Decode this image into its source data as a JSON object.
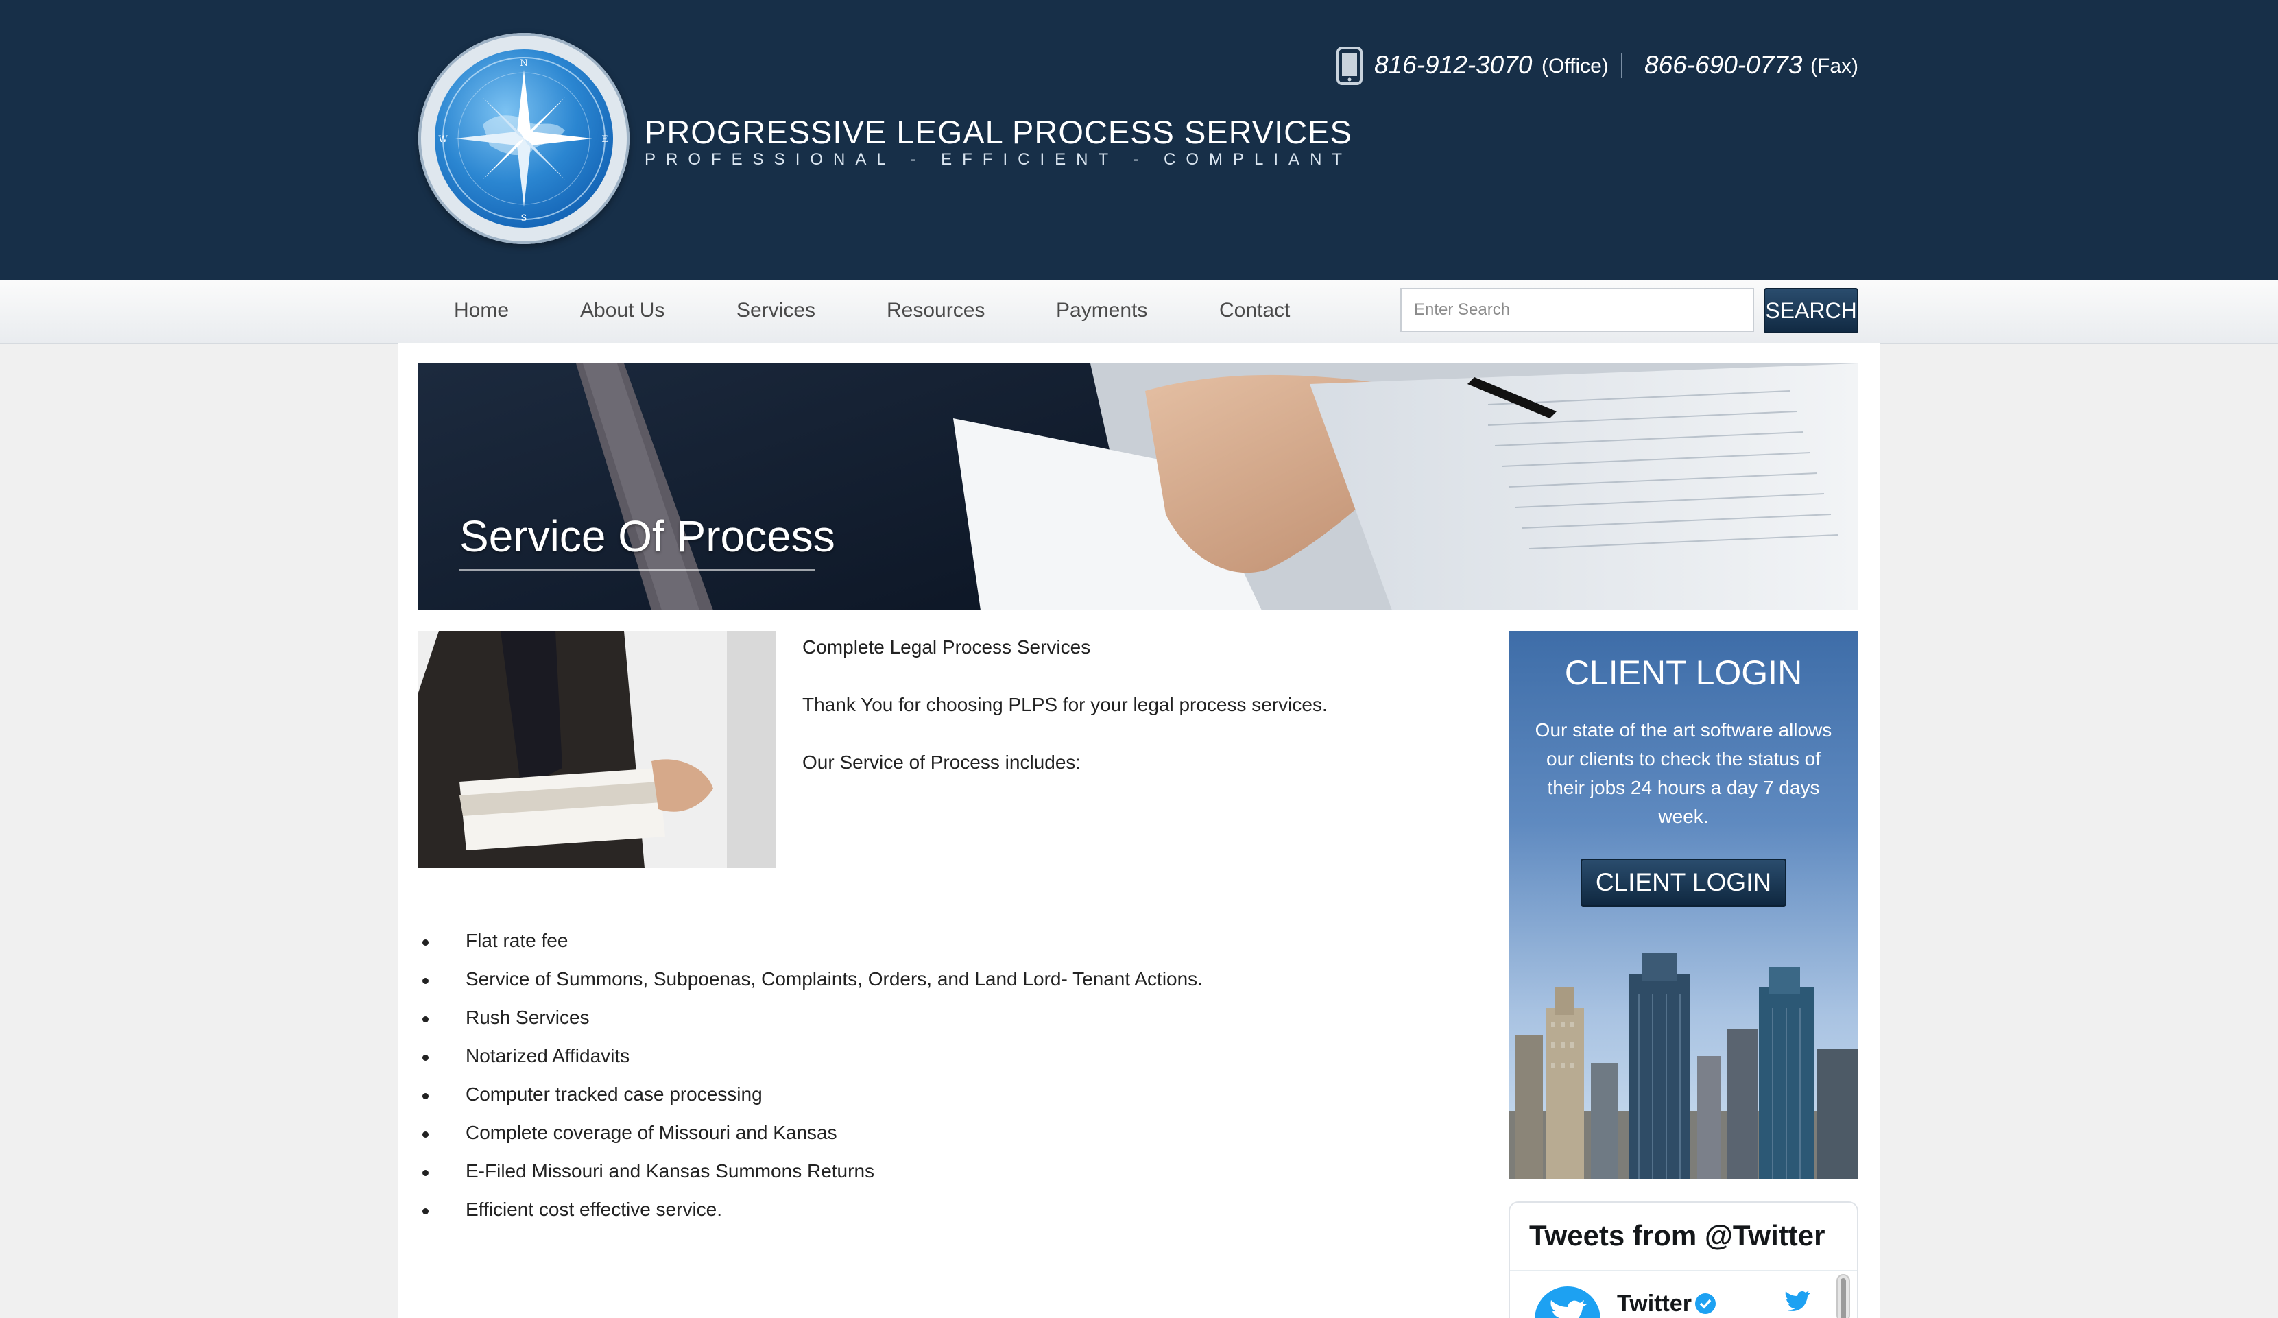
{
  "header": {
    "logo_title": "PROGRESSIVE LEGAL PROCESS SERVICES",
    "logo_tagline": "PROFESSIONAL - EFFICIENT - COMPLIANT",
    "phone_office": "816-912-3070",
    "phone_office_label": "(Office)",
    "phone_fax": "866-690-0773",
    "phone_fax_label": "(Fax)",
    "compass_letters": {
      "n": "N",
      "s": "S",
      "e": "E",
      "w": "W"
    }
  },
  "nav": {
    "items": [
      {
        "label": "Home"
      },
      {
        "label": "About Us"
      },
      {
        "label": "Services"
      },
      {
        "label": "Resources"
      },
      {
        "label": "Payments"
      },
      {
        "label": "Contact"
      }
    ],
    "search_placeholder": "Enter Search",
    "search_button": "SEARCH"
  },
  "banner": {
    "title": "Service Of Process"
  },
  "main": {
    "intro": [
      "Complete Legal Process Services",
      "Thank You for choosing PLPS for your legal process services.",
      "Our Service of Process includes:"
    ],
    "bullets": [
      "Flat rate fee",
      "Service of Summons, Subpoenas, Complaints, Orders, and Land Lord- Tenant Actions.",
      "Rush Services",
      "Notarized Affidavits",
      "Computer tracked case processing",
      "Complete coverage of Missouri and Kansas",
      "E-Filed Missouri and Kansas Summons Returns",
      "Efficient cost effective service."
    ]
  },
  "client_login": {
    "title": "CLIENT LOGIN",
    "text": "Our state of the art software allows our clients to check the status of their jobs 24 hours a day 7 days week.",
    "button": "CLIENT LOGIN"
  },
  "twitter": {
    "title": "Tweets from @Twitter",
    "account_name": "Twitter"
  },
  "icons": {
    "phone": "phone-icon",
    "compass": "compass-icon",
    "verified": "verified-badge-icon",
    "bird": "twitter-bird-icon"
  },
  "colors": {
    "header_bg": "#172f48",
    "button_bg": "#1b3a58",
    "twitter_blue": "#1da1f2"
  }
}
